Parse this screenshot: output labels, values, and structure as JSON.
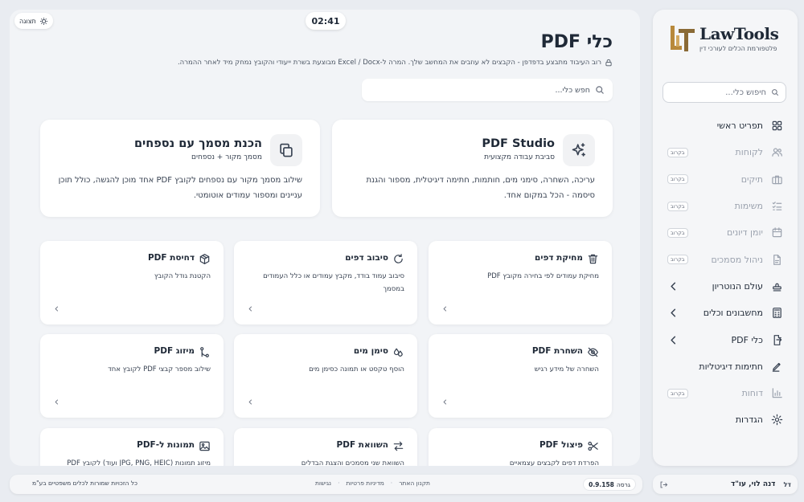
{
  "brand": {
    "name": "LawTools",
    "tagline": "פלטפורמת הכלים לעורכי דין"
  },
  "sidebar": {
    "search_placeholder": "חיפוש כלי...",
    "soon_label": "בקרוב",
    "items": [
      {
        "label": "תפריט ראשי",
        "icon": "grid-icon",
        "state": "active"
      },
      {
        "label": "לקוחות",
        "icon": "users-icon",
        "state": "soon"
      },
      {
        "label": "תיקים",
        "icon": "briefcase-icon",
        "state": "soon"
      },
      {
        "label": "משימות",
        "icon": "checklist-icon",
        "state": "soon"
      },
      {
        "label": "יומן דיונים",
        "icon": "calendar-icon",
        "state": "soon"
      },
      {
        "label": "ניהול מסמכים",
        "icon": "file-icon",
        "state": "soon"
      },
      {
        "label": "עולם הנוטריון",
        "icon": "stamp-icon",
        "state": "expandable"
      },
      {
        "label": "מחשבונים וכלים",
        "icon": "calculator-icon",
        "state": "expandable"
      },
      {
        "label": "כלי PDF",
        "icon": "file-export-icon",
        "state": "expandable"
      },
      {
        "label": "חתימות דיגיטליות",
        "icon": "signature-icon",
        "state": "active"
      },
      {
        "label": "דוחות",
        "icon": "bar-chart-icon",
        "state": "soon"
      },
      {
        "label": "הגדרות",
        "icon": "gear-icon",
        "state": "active"
      }
    ]
  },
  "user": {
    "initials": "דל",
    "name": "דנה לוי, עו\"ד"
  },
  "topbar": {
    "theme_label": "תצוגה",
    "timer": "02:41"
  },
  "page": {
    "title": "כלי PDF",
    "subtitle": "רוב העיבוד מתבצע בדפדפן - הקבצים לא עוזבים את המחשב שלך. המרה ל-Excel / Docx מבוצעת בשרת ייעודי והקובץ נמחק מיד לאחר ההמרה.",
    "search_placeholder": "חפש כלי..."
  },
  "features": [
    {
      "title": "PDF Studio",
      "subtitle": "סביבת עבודה מקצועית",
      "description": "עריכה, השחרה, סימני מים, חותמות, חתימה דיגיטלית, מספור והגנת סיסמה - הכל במקום אחד.",
      "icon": "sparkles-icon"
    },
    {
      "title": "הכנת מסמך עם נספחים",
      "subtitle": "מסמך מקור + נספחים",
      "description": "שילוב מסמך מקור עם נספחים לקובץ PDF אחד מוכן להגשה, כולל תוכן עניינים ומספור עמודים אוטומטי.",
      "icon": "copy-icon"
    }
  ],
  "tools": [
    {
      "title": "מחיקת דפים",
      "description": "מחיקת עמודים לפי בחירה מקובץ PDF",
      "icon": "trash-icon"
    },
    {
      "title": "סיבוב דפים",
      "description": "סיבוב עמוד בודד, מקבץ עמודים או כלל העמודים במסמך",
      "icon": "rotate-icon"
    },
    {
      "title": "דחיסת PDF",
      "description": "הקטנת גודל הקובץ",
      "icon": "package-icon"
    },
    {
      "title": "השחרת PDF",
      "description": "השחרה של מידע רגיש",
      "icon": "eye-off-icon"
    },
    {
      "title": "סימן מים",
      "description": "הוסף טקסט או תמונה כסימן מים",
      "icon": "droplets-icon"
    },
    {
      "title": "מיזוג PDF",
      "description": "שילוב מספר קבצי PDF לקובץ אחד",
      "icon": "merge-icon"
    },
    {
      "title": "פיצול PDF",
      "description": "הפרדת דפים לקבצים עצמאיים",
      "icon": "scissors-icon"
    },
    {
      "title": "השוואת PDF",
      "description": "השוואת שני מסמכים והצגת הבדלים",
      "icon": "compare-icon"
    },
    {
      "title": "תמונות ל-PDF",
      "description": "מיזוג תמונות (JPG, PNG, HEIC ועוד) לקובץ PDF",
      "icon": "image-icon"
    }
  ],
  "footer": {
    "version_label": "גרסה",
    "version": "0.9.158",
    "links": [
      "תקנון האתר",
      "מדיניות פרטיות",
      "נגישות"
    ],
    "link_separator": "·",
    "copyright": "כל הזכויות שמורות לכלים משפטיים בע\"מ"
  },
  "colors": {
    "background": "#e9ecf1",
    "panel": "#f2f4f7",
    "card": "#ffffff",
    "logo_gold": "#b8893b",
    "text": "#1f2937"
  }
}
